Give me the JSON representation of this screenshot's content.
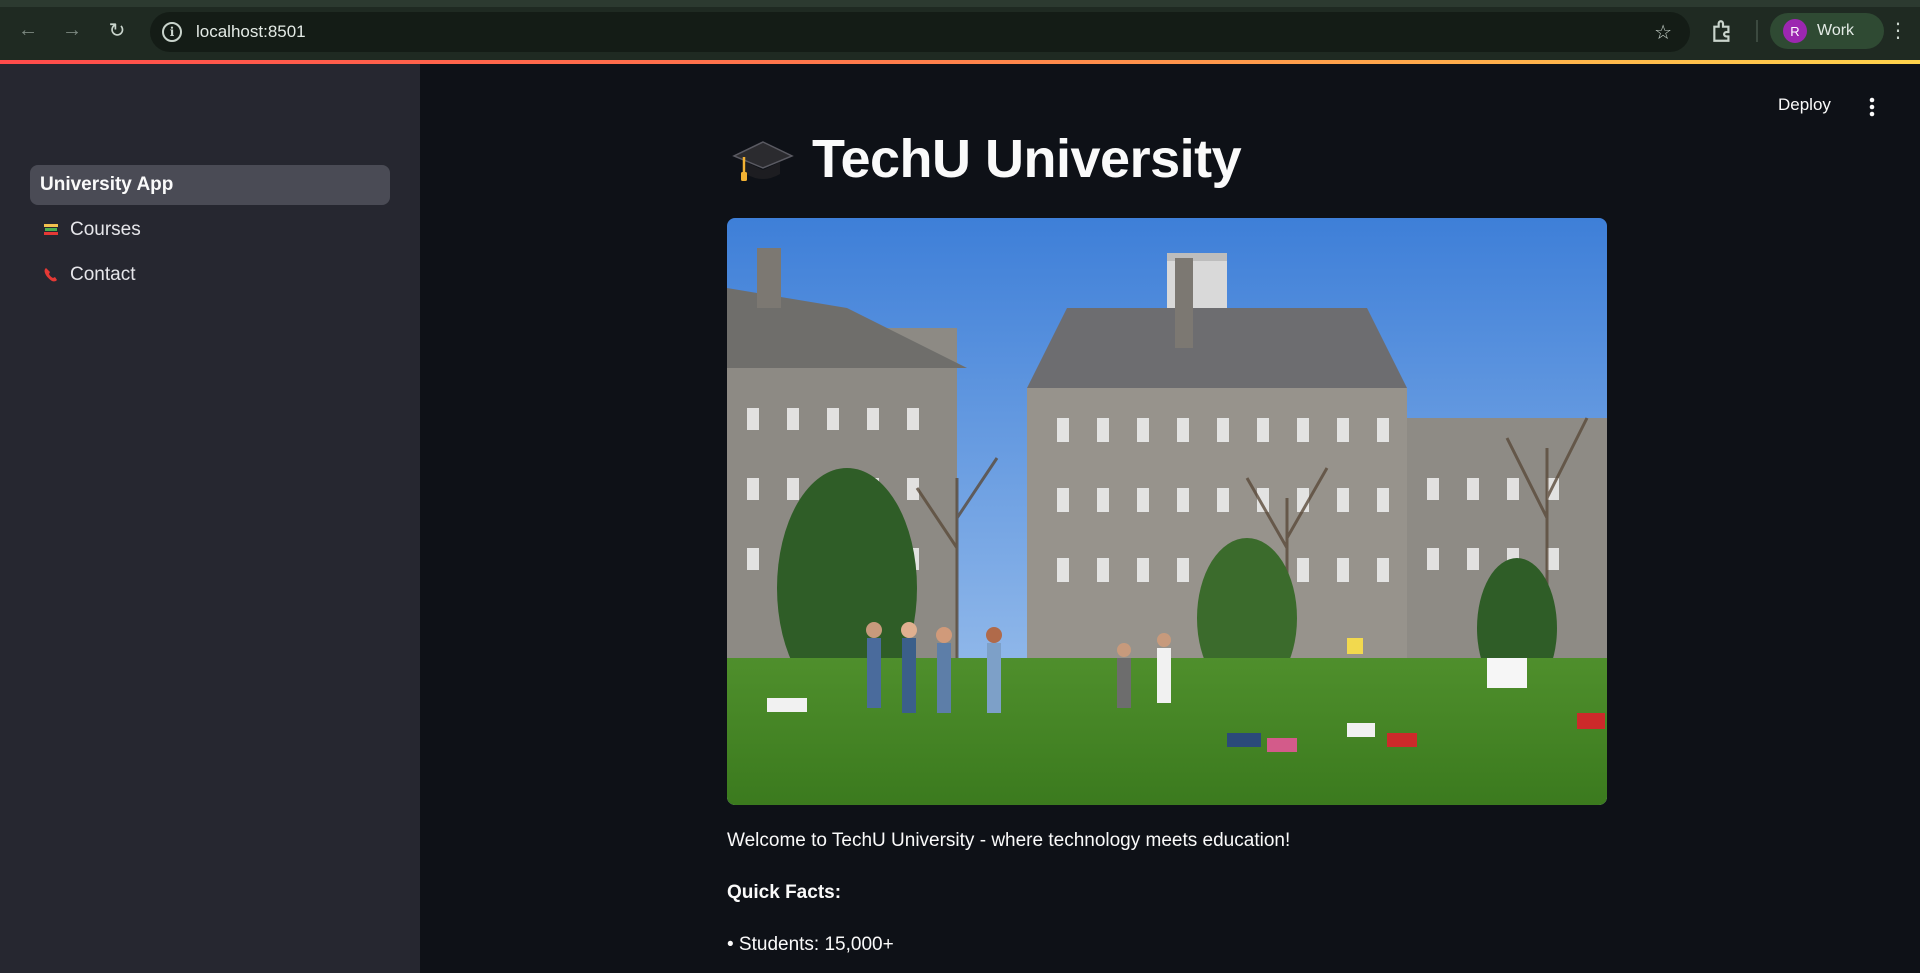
{
  "browser": {
    "url": "localhost:8501",
    "profile_initial": "R",
    "profile_label": "Work"
  },
  "sidebar": {
    "items": [
      {
        "label": "University App",
        "icon": "none",
        "active": true
      },
      {
        "label": "Courses",
        "icon": "books-icon",
        "active": false
      },
      {
        "label": "Contact",
        "icon": "phone-icon",
        "active": false
      }
    ]
  },
  "header": {
    "deploy_label": "Deploy"
  },
  "main": {
    "title": "TechU University",
    "title_icon": "graduation-cap-icon",
    "welcome": "Welcome to TechU University - where technology meets education!",
    "quick_facts_heading": "Quick Facts:",
    "facts": [
      "• Students: 15,000+"
    ]
  },
  "colors": {
    "accent": "#ff4b4b",
    "background": "#0e1117",
    "sidebar": "#262730",
    "text": "#fafafa"
  }
}
